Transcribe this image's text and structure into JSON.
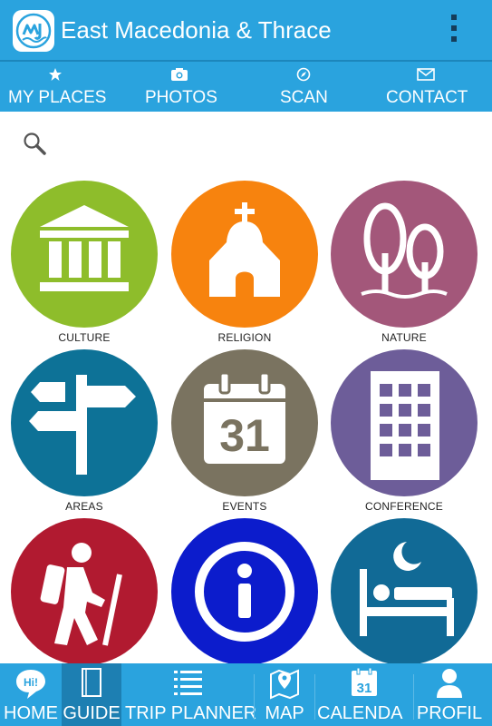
{
  "app": {
    "title": "East Macedonia & Thrace",
    "logo": "mt-logo-icon",
    "accent_color": "#2aa3de"
  },
  "top_nav": [
    {
      "label": "MY PLACES",
      "icon": "star-icon"
    },
    {
      "label": "PHOTOS",
      "icon": "camera-icon"
    },
    {
      "label": "SCAN",
      "icon": "compass-icon"
    },
    {
      "label": "CONTACT",
      "icon": "envelope-icon"
    }
  ],
  "search": {
    "icon": "search-icon"
  },
  "categories": [
    {
      "label": "CULTURE",
      "icon": "temple-icon",
      "color": "#8ebd2b"
    },
    {
      "label": "RELIGION",
      "icon": "church-icon",
      "color": "#f7830e"
    },
    {
      "label": "NATURE",
      "icon": "trees-icon",
      "color": "#a3577a"
    },
    {
      "label": "AREAS",
      "icon": "signpost-icon",
      "color": "#0d7297"
    },
    {
      "label": "EVENTS",
      "icon": "calendar-icon",
      "color": "#7a7360",
      "calendar_day": "31"
    },
    {
      "label": "CONFERENCE",
      "icon": "building-icon",
      "color": "#6d5d99"
    },
    {
      "label": "",
      "icon": "hiker-icon",
      "color": "#b11a30"
    },
    {
      "label": "",
      "icon": "info-icon",
      "color": "#0c1ccc"
    },
    {
      "label": "",
      "icon": "bed-icon",
      "color": "#116a96"
    }
  ],
  "bottom_nav": [
    {
      "label": "HOME",
      "icon": "hi-bubble-icon",
      "icon_text": "Hi!",
      "active": false
    },
    {
      "label": "GUIDE",
      "icon": "book-icon",
      "active": true
    },
    {
      "label": "TRIP PLANNER",
      "icon": "list-icon",
      "active": false
    },
    {
      "label": "MAP",
      "icon": "map-pin-icon",
      "active": false
    },
    {
      "label": "CALENDA",
      "icon": "calendar-icon",
      "icon_text": "31",
      "active": false
    },
    {
      "label": "PROFIL",
      "icon": "person-icon",
      "active": false
    }
  ]
}
